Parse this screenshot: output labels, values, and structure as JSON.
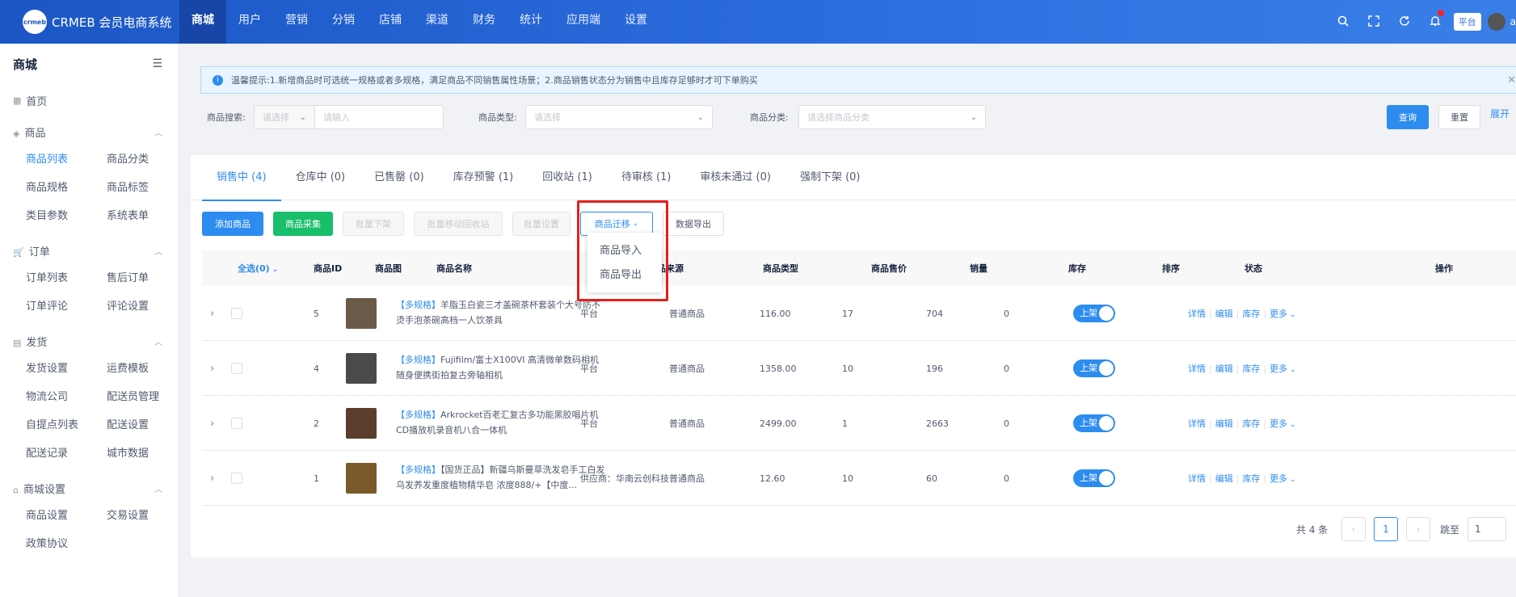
{
  "header": {
    "logo_text": "crmeb",
    "brand": "CRMEB 会员电商系统",
    "nav": [
      "商城",
      "用户",
      "营销",
      "分销",
      "店铺",
      "渠道",
      "财务",
      "统计",
      "应用端",
      "设置"
    ],
    "platform_label": "平台",
    "username": "a"
  },
  "sidebar": {
    "title": "商城",
    "home": "首页",
    "groups": [
      {
        "label": "商品",
        "items": [
          "商品列表",
          "商品分类",
          "商品规格",
          "商品标签",
          "类目参数",
          "系统表单"
        ]
      },
      {
        "label": "订单",
        "items": [
          "订单列表",
          "售后订单",
          "订单评论",
          "评论设置"
        ]
      },
      {
        "label": "发货",
        "items": [
          "发货设置",
          "运费模板",
          "物流公司",
          "配送员管理",
          "自提点列表",
          "配送设置",
          "配送记录",
          "城市数据"
        ]
      },
      {
        "label": "商城设置",
        "items": [
          "商品设置",
          "交易设置",
          "政策协议"
        ]
      }
    ]
  },
  "notice": "温馨提示:1.新增商品时可选统一规格或者多规格，满足商品不同销售属性场景；2.商品销售状态分为销售中且库存足够时才可下单购买",
  "filters": {
    "search_label": "商品搜索:",
    "search_select_placeholder": "请选择",
    "search_input_placeholder": "请输入",
    "type_label": "商品类型:",
    "type_placeholder": "请选择",
    "category_label": "商品分类:",
    "category_placeholder": "请选择商品分类",
    "query": "查询",
    "reset": "重置",
    "expand": "展开"
  },
  "tabs": [
    "销售中 (4)",
    "仓库中 (0)",
    "已售罄 (0)",
    "库存预警 (1)",
    "回收站 (1)",
    "待审核 (1)",
    "审核未通过 (0)",
    "强制下架 (0)"
  ],
  "actions": {
    "add": "添加商品",
    "collect": "商品采集",
    "batch_off": "批量下架",
    "batch_recycle": "批量移动回收站",
    "batch_set": "批量设置",
    "migrate": "商品迁移",
    "export": "数据导出"
  },
  "dropdown": [
    "商品导入",
    "商品导出"
  ],
  "table": {
    "select_all": "全选(0)",
    "columns": [
      "商品ID",
      "商品图",
      "商品名称",
      "商品来源",
      "商品类型",
      "商品售价",
      "销量",
      "库存",
      "排序",
      "状态",
      "操作"
    ],
    "rows": [
      {
        "id": "5",
        "tag": "【多规格】",
        "name": "羊脂玉白瓷三才盖碗茶杯套装个大号防不烫手泡茶碗高档一人饮茶具",
        "source": "平台",
        "type": "普通商品",
        "price": "116.00",
        "sales": "17",
        "stock": "704",
        "sort": "0",
        "status": "上架",
        "img_color": "#6b5a48"
      },
      {
        "id": "4",
        "tag": "【多规格】",
        "name": "Fujifilm/富士X100VI 高清微单数码相机随身便携街拍复古旁轴相机",
        "source": "平台",
        "type": "普通商品",
        "price": "1358.00",
        "sales": "10",
        "stock": "196",
        "sort": "0",
        "status": "上架",
        "img_color": "#4a4a4a"
      },
      {
        "id": "2",
        "tag": "【多规格】",
        "name": "Arkrocket百老汇复古多功能黑胶唱片机CD播放机录音机八合一体机",
        "source": "平台",
        "type": "普通商品",
        "price": "2499.00",
        "sales": "1",
        "stock": "2663",
        "sort": "0",
        "status": "上架",
        "img_color": "#5a3e2b"
      },
      {
        "id": "1",
        "tag": "【多规格】",
        "name": "【国货正品】新疆乌斯曼草洗发皂手工白发乌发养发重度植物精华皂 浓度888/+【中度...",
        "source": "供应商：华南云创科技",
        "type": "普通商品",
        "price": "12.60",
        "sales": "10",
        "stock": "60",
        "sort": "0",
        "status": "上架",
        "img_color": "#7a5a2a"
      }
    ],
    "ops": [
      "详情",
      "编辑",
      "库存",
      "更多"
    ]
  },
  "pager": {
    "total": "共 4 条",
    "current": "1",
    "goto_label": "跳至",
    "goto_value": "1"
  }
}
